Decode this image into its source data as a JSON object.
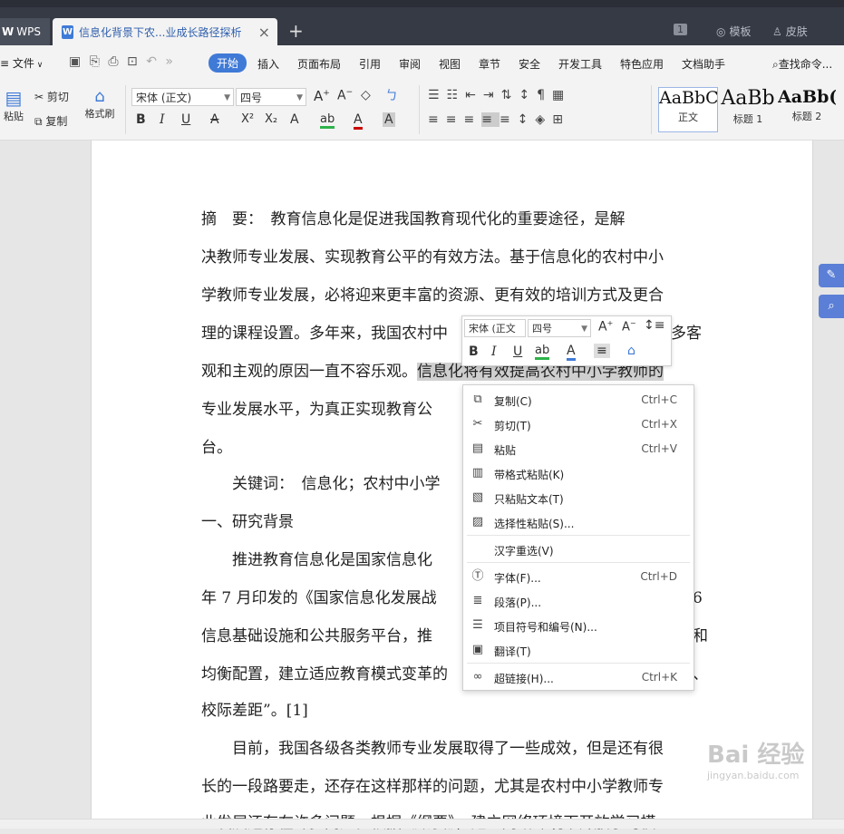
{
  "tabs": {
    "app_label": "WPS",
    "app_icon": "wps-logo-icon",
    "doc_title": "信息化背景下农...业成长路径探析",
    "page_badge": "1",
    "template_label": "模板",
    "skin_label": "皮肤"
  },
  "menu": {
    "file": "文件",
    "items": [
      "开始",
      "插入",
      "页面布局",
      "引用",
      "审阅",
      "视图",
      "章节",
      "安全",
      "开发工具",
      "特色应用",
      "文档助手"
    ],
    "search": "查找命令..."
  },
  "toolbar": {
    "paste": "粘贴",
    "cut": "剪切",
    "copy": "复制",
    "format_painter": "格式刷",
    "font_name": "宋体 (正文)",
    "font_size": "四号",
    "bold": "B",
    "italic": "I",
    "underline": "U",
    "styles": [
      {
        "sample": "AaBbC",
        "name": "正文"
      },
      {
        "sample": "AaBb",
        "name": "标题 1"
      },
      {
        "sample": "AaBb(",
        "name": "标题 2"
      }
    ]
  },
  "document": {
    "lines": [
      "摘　要：　教育信息化是促进我国教育现代化的重要途径，是解",
      "决教师专业发展、实现教育公平的有效方法。基于信息化的农村中小",
      "学教师专业发展，必将迎来更丰富的资源、更有效的培训方式及更合",
      "理的课程设置。多年来，我国农村中",
      "观和主观的原因一直不容乐观。",
      "专业发展水平，为真正实现教育公",
      "台。",
      "　　关键词：　信息化；农村中小学",
      "一、研究背景",
      "　　推进教育信息化是国家信息化",
      "年 7 月印发的《国家信息化发展战",
      "信息基础设施和公共服务平台，推",
      "均衡配置，建立适应教育模式变革的",
      "校际差距”。[1]",
      "　　目前，我国各级各类教师专业发展取得了一些成效，但是还有很",
      "长的一段路要走，还存在这样那样的问题，尤其是农村中小学教师专",
      "业发展还存在许多问题。根据《纲要》，建立网络环境下开放学习模"
    ],
    "highlight": "信息化将有效提高农村中小学教师的",
    "right_fragments": [
      "多客",
      "学",
      "6",
      "育",
      "和",
      "、"
    ]
  },
  "mini_toolbar": {
    "font_name": "宋体 (正文",
    "font_size": "四号"
  },
  "context_menu": {
    "items": [
      {
        "label": "复制(C)",
        "shortcut": "Ctrl+C",
        "icon": "copy-icon"
      },
      {
        "label": "剪切(T)",
        "shortcut": "Ctrl+X",
        "icon": "cut-icon"
      },
      {
        "label": "粘贴",
        "shortcut": "Ctrl+V",
        "icon": "paste-icon"
      },
      {
        "label": "带格式粘贴(K)",
        "shortcut": "",
        "icon": "paste-format-icon"
      },
      {
        "label": "只粘贴文本(T)",
        "shortcut": "",
        "icon": "paste-text-icon"
      },
      {
        "label": "选择性粘贴(S)...",
        "shortcut": "",
        "icon": "paste-special-icon"
      },
      {
        "label": "汉字重选(V)",
        "shortcut": "",
        "icon": ""
      },
      {
        "label": "字体(F)...",
        "shortcut": "Ctrl+D",
        "icon": "font-icon"
      },
      {
        "label": "段落(P)...",
        "shortcut": "",
        "icon": "paragraph-icon"
      },
      {
        "label": "项目符号和编号(N)...",
        "shortcut": "",
        "icon": "bullets-icon"
      },
      {
        "label": "翻译(T)",
        "shortcut": "",
        "icon": "translate-icon"
      },
      {
        "label": "超链接(H)...",
        "shortcut": "Ctrl+K",
        "icon": "hyperlink-icon"
      }
    ]
  },
  "watermark": {
    "text": "Bai 经验",
    "sub": "jingyan.baidu.com"
  },
  "colors": {
    "accent": "#3f7ad7",
    "tabbar": "#363a45",
    "highlight": "#cfcfcf"
  }
}
